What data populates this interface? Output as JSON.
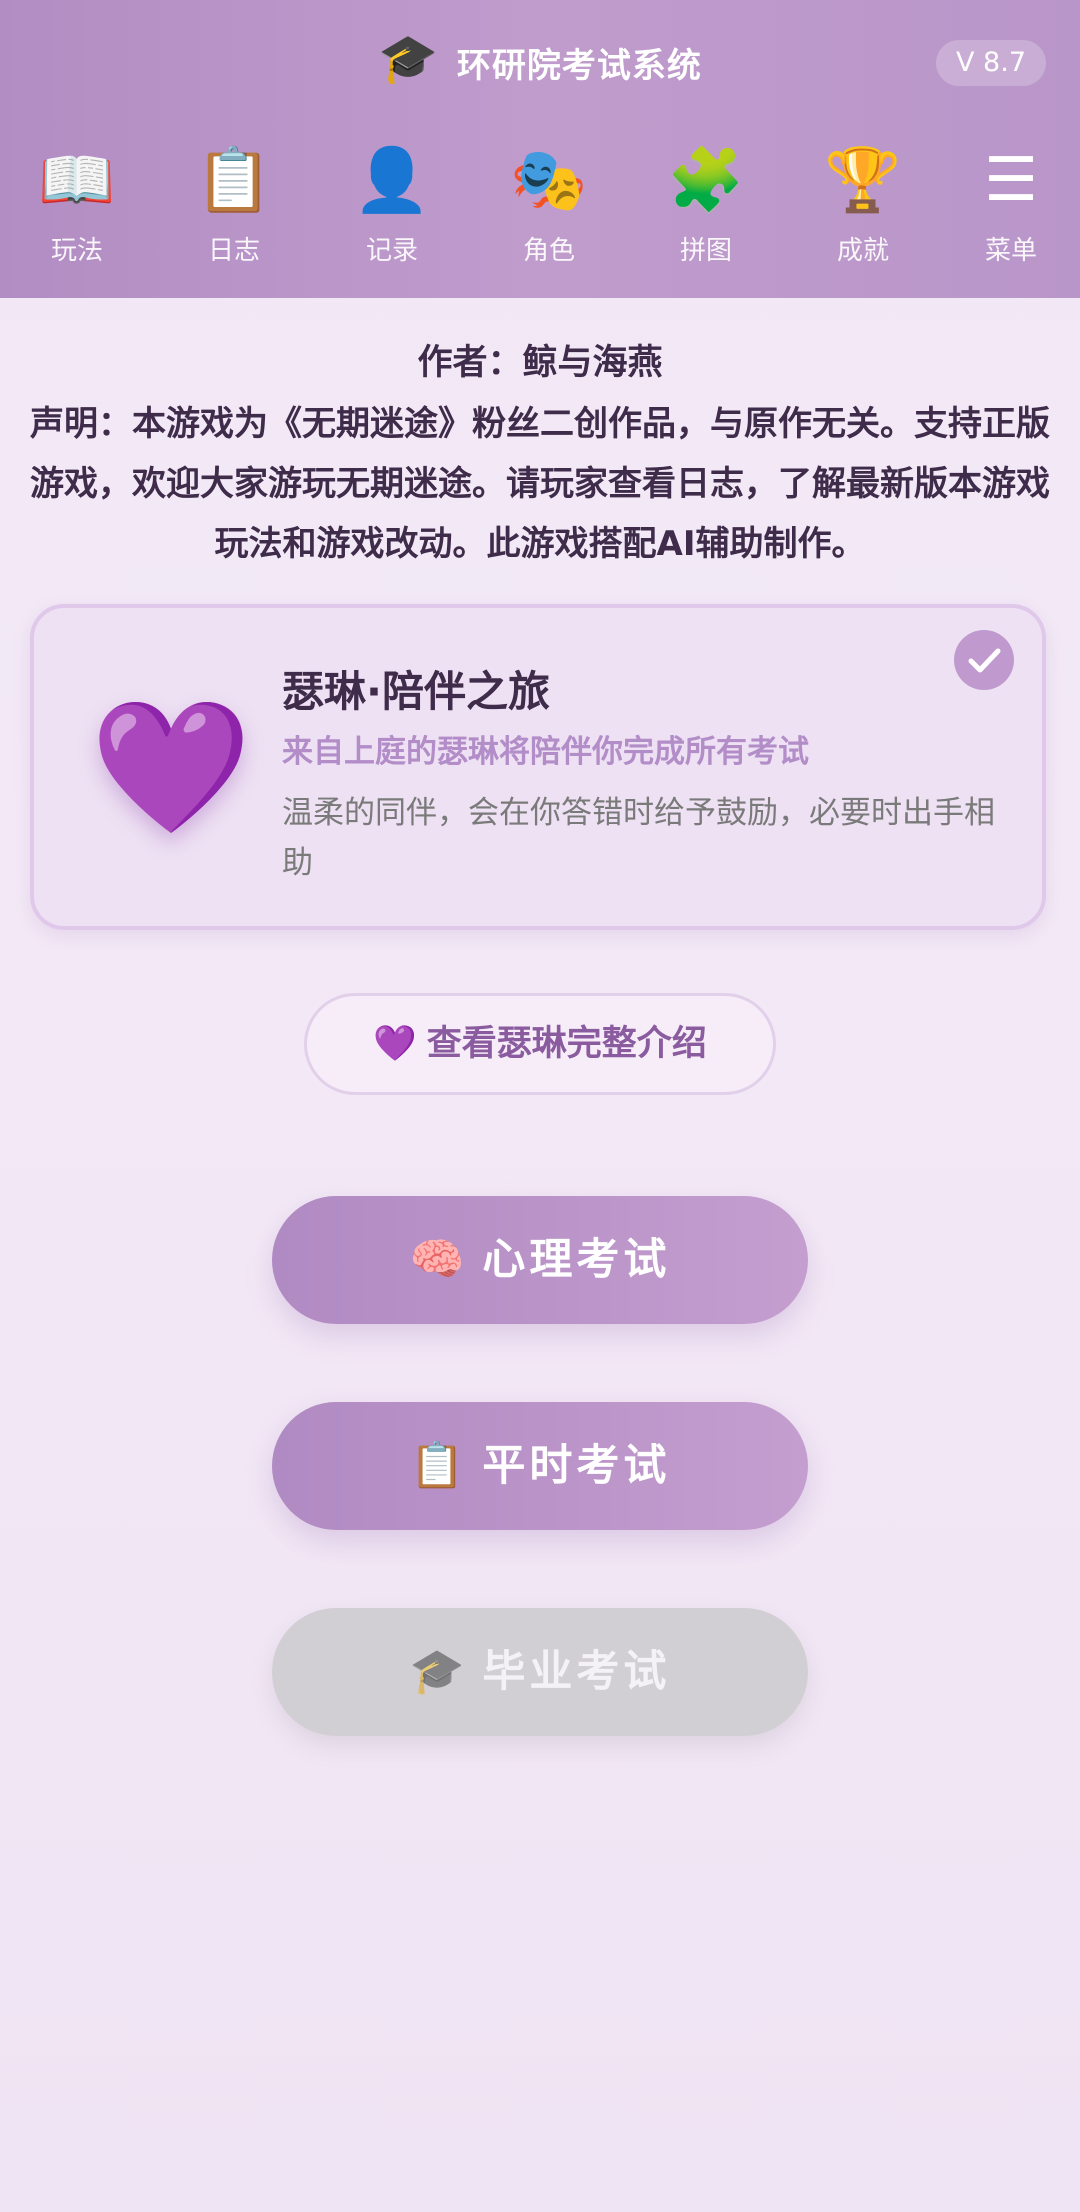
{
  "header": {
    "title": "环研院考试系统",
    "title_icon": "graduation-cap-icon",
    "version": "V 8.7",
    "background_color": "#b892c6"
  },
  "nav": {
    "items": [
      {
        "label": "玩法",
        "icon": "📖",
        "icon_name": "open-book-icon"
      },
      {
        "label": "日志",
        "icon": "📋",
        "icon_name": "clipboard-icon"
      },
      {
        "label": "记录",
        "icon": "👤",
        "icon_name": "person-icon"
      },
      {
        "label": "角色",
        "icon": "🎭",
        "icon_name": "theater-masks-icon"
      },
      {
        "label": "拼图",
        "icon": "🧩",
        "icon_name": "puzzle-icon"
      },
      {
        "label": "成就",
        "icon": "🏆",
        "icon_name": "trophy-icon"
      },
      {
        "label": "菜单",
        "icon": "☰",
        "icon_name": "menu-icon"
      }
    ]
  },
  "main": {
    "author": "作者：鲸与海燕",
    "statement": "声明：本游戏为《无期迷途》粉丝二创作品，与原作无关。支持正版游戏，欢迎大家游玩无期迷途。请玩家查看日志，了解最新版本游戏玩法和游戏改动。此游戏搭配AI辅助制作。",
    "companion_card": {
      "icon": "💜",
      "title": "瑟琳·陪伴之旅",
      "subtitle": "来自上庭的瑟琳将陪伴你完成所有考试",
      "description": "温柔的同伴，会在你答错时给予鼓励，必要时出手相助",
      "selected": true
    },
    "intro_button": {
      "icon": "💜",
      "label": "查看瑟琳完整介绍"
    },
    "exam_buttons": [
      {
        "icon": "🧠",
        "label": "心理考试",
        "enabled": true
      },
      {
        "icon": "📋",
        "label": "平时考试",
        "enabled": true
      },
      {
        "icon": "🎓",
        "label": "毕业考试",
        "enabled": false
      }
    ]
  },
  "colors": {
    "accent": "#b892c6",
    "text_dark": "#3f2b4a",
    "subtitle": "#b28dc8",
    "disabled": "#d2cfd4"
  }
}
